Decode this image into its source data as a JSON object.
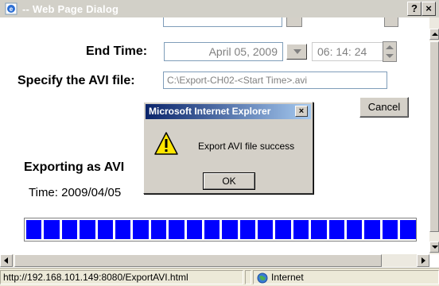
{
  "window": {
    "title": "-- Web Page Dialog",
    "help_label": "?",
    "close_label": "×"
  },
  "form": {
    "end_time_label": "End Time:",
    "end_date_value": "April 05, 2009",
    "end_time_value": "06: 14: 24",
    "avi_label": "Specify the AVI file:",
    "avi_value": "C:\\Export-CH02-<Start Time>.avi",
    "cancel_label": "Cancel",
    "exporting_label": "Exporting as AVI",
    "time_label": "Time: 2009/04/05"
  },
  "progress": {
    "fraction": 1.0,
    "color": "#0000ff"
  },
  "dialog": {
    "title": "Microsoft Internet Explorer",
    "close_label": "×",
    "message": "Export AVI file success",
    "ok_label": "OK",
    "icon": "warning-icon"
  },
  "statusbar": {
    "url": "http://192.168.101.149:8080/ExportAVI.html",
    "zone": "Internet"
  }
}
